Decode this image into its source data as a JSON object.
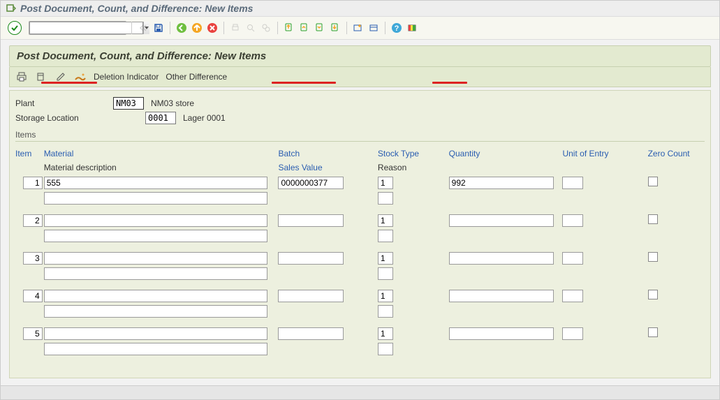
{
  "window": {
    "title": "Post Document, Count, and Difference: New Items"
  },
  "app": {
    "title": "Post Document, Count, and Difference: New Items"
  },
  "app_toolbar": {
    "deletion_indicator": "Deletion Indicator",
    "other_difference": "Other Difference"
  },
  "header": {
    "plant_label": "Plant",
    "plant_code": "NM03",
    "plant_text": "NM03 store",
    "sloc_label": "Storage Location",
    "sloc_code": "0001",
    "sloc_text": "Lager 0001"
  },
  "section": {
    "items": "Items"
  },
  "cols": {
    "item": "Item",
    "material": "Material",
    "batch": "Batch",
    "stock_type": "Stock Type",
    "quantity": "Quantity",
    "uoe": "Unit of Entry",
    "zero_count": "Zero Count",
    "mat_desc": "Material description",
    "sales_value": "Sales Value",
    "reason": "Reason"
  },
  "rows": [
    {
      "no": "1",
      "material": "555",
      "batch": "0000000377",
      "stock_type": "1",
      "quantity": "992",
      "uoe": "",
      "zero": false,
      "desc": "",
      "sales": "",
      "reason": ""
    },
    {
      "no": "2",
      "material": "",
      "batch": "",
      "stock_type": "1",
      "quantity": "",
      "uoe": "",
      "zero": false,
      "desc": "",
      "sales": "",
      "reason": ""
    },
    {
      "no": "3",
      "material": "",
      "batch": "",
      "stock_type": "1",
      "quantity": "",
      "uoe": "",
      "zero": false,
      "desc": "",
      "sales": "",
      "reason": ""
    },
    {
      "no": "4",
      "material": "",
      "batch": "",
      "stock_type": "1",
      "quantity": "",
      "uoe": "",
      "zero": false,
      "desc": "",
      "sales": "",
      "reason": ""
    },
    {
      "no": "5",
      "material": "",
      "batch": "",
      "stock_type": "1",
      "quantity": "",
      "uoe": "",
      "zero": false,
      "desc": "",
      "sales": "",
      "reason": ""
    }
  ]
}
